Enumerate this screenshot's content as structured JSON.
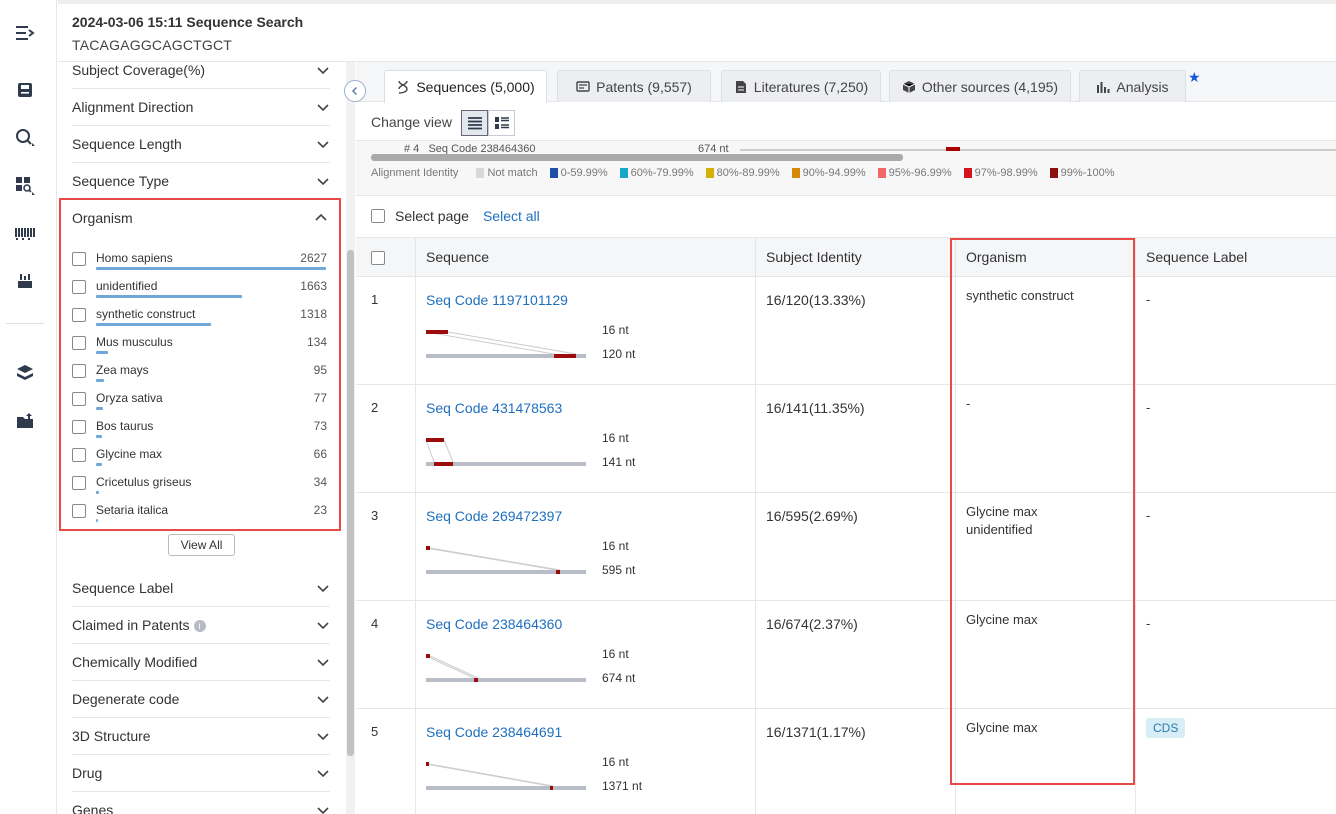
{
  "header": {
    "title": "2024-03-06 15:11 Sequence Search",
    "query": "TACAGAGGCAGCTGCT"
  },
  "rail": {
    "icons": [
      "menu-expand-icon",
      "save-icon",
      "search-icon",
      "grid-search-icon",
      "barcode-icon",
      "lab-icon",
      "layers-icon",
      "folder-upload-icon"
    ]
  },
  "filters": {
    "sections_top": [
      {
        "label": "Subject Coverage(%)"
      },
      {
        "label": "Alignment Direction"
      },
      {
        "label": "Sequence Length"
      },
      {
        "label": "Sequence Type"
      }
    ],
    "organism": {
      "label": "Organism",
      "items": [
        {
          "name": "Homo sapiens",
          "count": "2627",
          "frac": 1.0
        },
        {
          "name": "unidentified",
          "count": "1663",
          "frac": 0.633
        },
        {
          "name": "synthetic construct",
          "count": "1318",
          "frac": 0.502
        },
        {
          "name": "Mus musculus",
          "count": "134",
          "frac": 0.051
        },
        {
          "name": "Zea mays",
          "count": "95",
          "frac": 0.036
        },
        {
          "name": "Oryza sativa",
          "count": "77",
          "frac": 0.029
        },
        {
          "name": "Bos taurus",
          "count": "73",
          "frac": 0.028
        },
        {
          "name": "Glycine max",
          "count": "66",
          "frac": 0.025
        },
        {
          "name": "Cricetulus griseus",
          "count": "34",
          "frac": 0.013
        },
        {
          "name": "Setaria italica",
          "count": "23",
          "frac": 0.009
        }
      ],
      "view_all": "View All"
    },
    "sections_bottom": [
      {
        "label": "Sequence Label"
      },
      {
        "label": "Claimed in Patents"
      },
      {
        "label": "Chemically Modified"
      },
      {
        "label": "Degenerate code"
      },
      {
        "label": "3D Structure"
      },
      {
        "label": "Drug"
      },
      {
        "label": "Genes"
      }
    ]
  },
  "tabs": [
    {
      "label": "Sequences (5,000)",
      "icon": "dna-icon",
      "active": true
    },
    {
      "label": "Patents (9,557)",
      "icon": "patent-icon",
      "active": false
    },
    {
      "label": "Literatures (7,250)",
      "icon": "document-icon",
      "active": false
    },
    {
      "label": "Other sources (4,195)",
      "icon": "box-icon",
      "active": false
    },
    {
      "label": "Analysis",
      "icon": "bar-chart-icon",
      "active": false
    }
  ],
  "view": {
    "change_view": "Change view"
  },
  "overview": {
    "row_index": "# 4",
    "row_code": "Seq Code 238464360",
    "row_len": "674 nt",
    "legend_title": "Alignment Identity",
    "legend": [
      {
        "label": "Not match",
        "color": "#d9d9d9"
      },
      {
        "label": "0-59.99%",
        "color": "#1f4fa8"
      },
      {
        "label": "60%-79.99%",
        "color": "#19a7c9"
      },
      {
        "label": "80%-89.99%",
        "color": "#d4b106"
      },
      {
        "label": "90%-94.99%",
        "color": "#d48806"
      },
      {
        "label": "95%-96.99%",
        "color": "#f26767"
      },
      {
        "label": "97%-98.99%",
        "color": "#d4141f"
      },
      {
        "label": "99%-100%",
        "color": "#8c1010"
      }
    ]
  },
  "selection": {
    "select_page": "Select page",
    "select_all": "Select all"
  },
  "table": {
    "headers": [
      "Sequence",
      "Subject Identity",
      "Organism",
      "Sequence Label"
    ],
    "rows": [
      {
        "idx": "1",
        "code": "Seq Code 1197101129",
        "q_len": "16 nt",
        "s_len": "120 nt",
        "identity": "16/120(13.33%)",
        "organism": "synthetic construct",
        "organism2": "",
        "label": "-",
        "cds": false
      },
      {
        "idx": "2",
        "code": "Seq Code 431478563",
        "q_len": "16 nt",
        "s_len": "141 nt",
        "identity": "16/141(11.35%)",
        "organism": "-",
        "organism2": "",
        "label": "-",
        "cds": false
      },
      {
        "idx": "3",
        "code": "Seq Code 269472397",
        "q_len": "16 nt",
        "s_len": "595 nt",
        "identity": "16/595(2.69%)",
        "organism": "Glycine max",
        "organism2": "unidentified",
        "label": "-",
        "cds": false
      },
      {
        "idx": "4",
        "code": "Seq Code 238464360",
        "q_len": "16 nt",
        "s_len": "674 nt",
        "identity": "16/674(2.37%)",
        "organism": "Glycine max",
        "organism2": "",
        "label": "-",
        "cds": false
      },
      {
        "idx": "5",
        "code": "Seq Code 238464691",
        "q_len": "16 nt",
        "s_len": "1371 nt",
        "identity": "16/1371(1.17%)",
        "organism": "Glycine max",
        "organism2": "",
        "label": "CDS",
        "cds": true
      }
    ]
  }
}
